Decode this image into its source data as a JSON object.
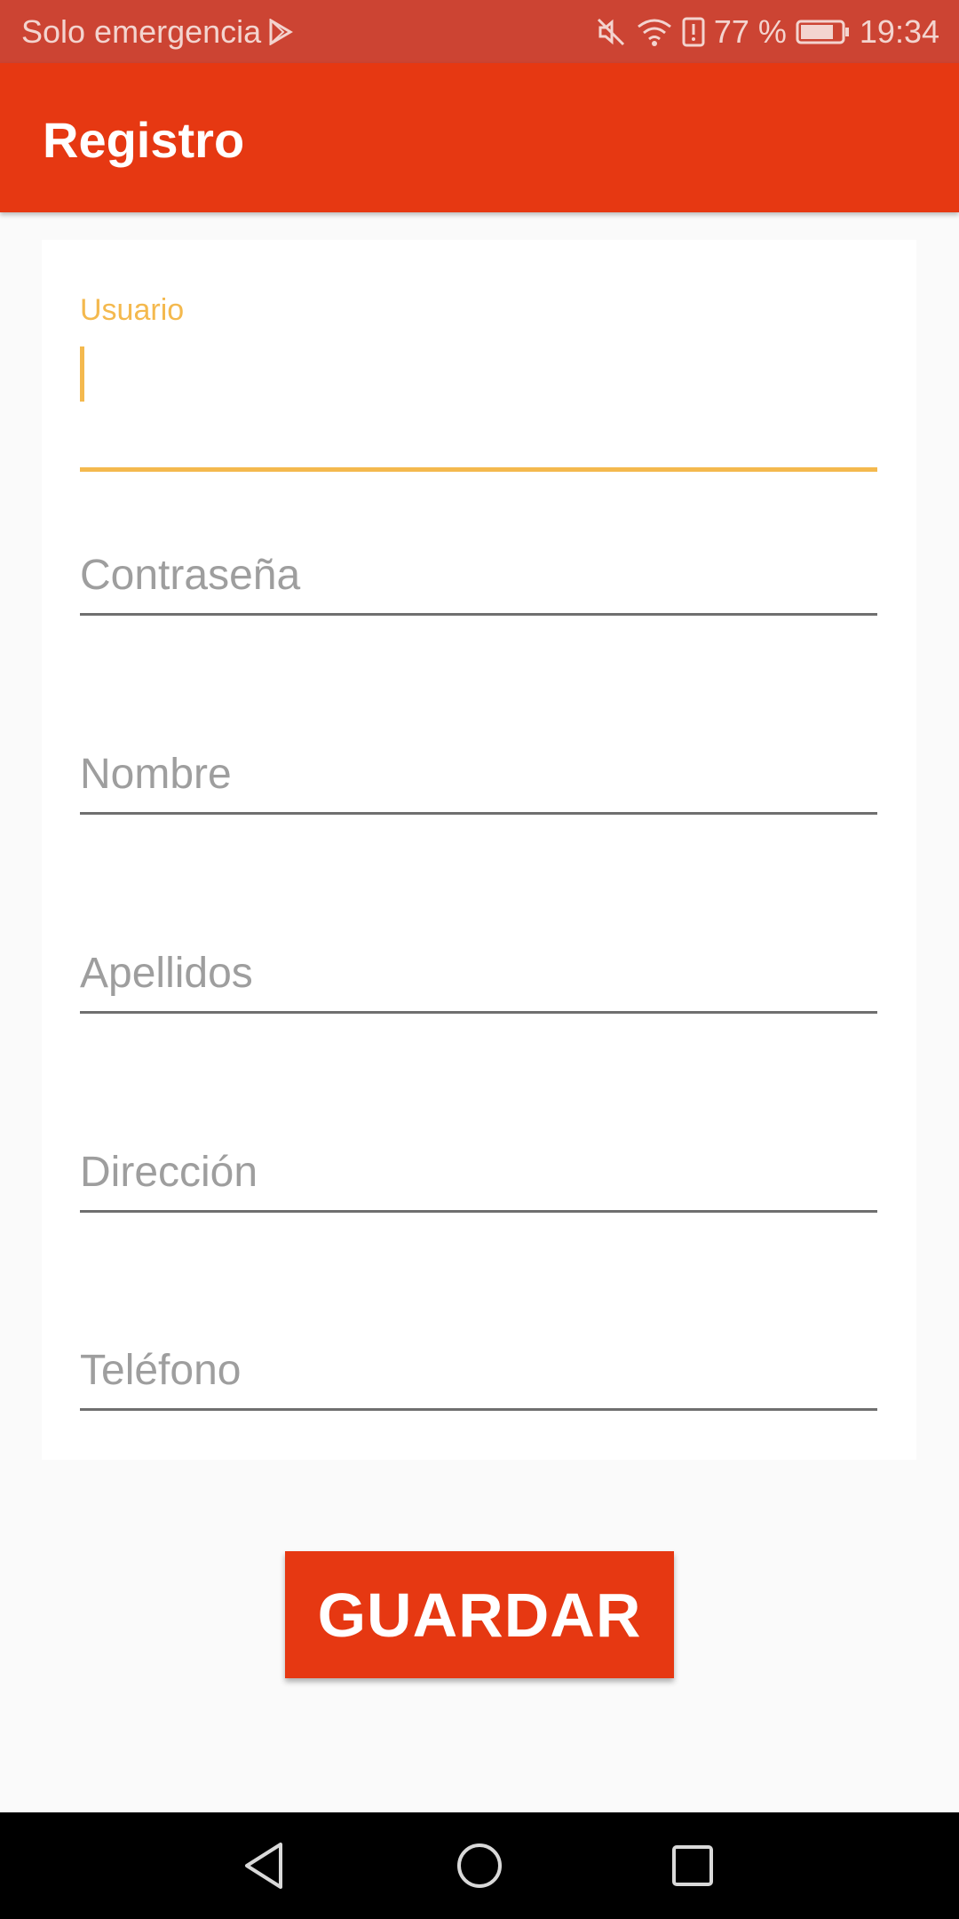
{
  "status_bar": {
    "carrier": "Solo emergencia",
    "battery": "77 %",
    "time": "19:34",
    "icons": [
      "play-store-icon",
      "mute-icon",
      "wifi-icon",
      "alert-icon",
      "battery-icon"
    ]
  },
  "app_bar": {
    "title": "Registro"
  },
  "form": {
    "usuario": {
      "label": "Usuario",
      "value": ""
    },
    "contrasena": {
      "placeholder": "Contraseña",
      "value": ""
    },
    "nombre": {
      "placeholder": "Nombre",
      "value": ""
    },
    "apellidos": {
      "placeholder": "Apellidos",
      "value": ""
    },
    "direccion": {
      "placeholder": "Dirección",
      "value": ""
    },
    "telefono": {
      "placeholder": "Teléfono",
      "value": ""
    }
  },
  "actions": {
    "save_label": "GUARDAR"
  },
  "nav_bar": {
    "icons": [
      "back-icon",
      "home-icon",
      "recents-icon"
    ]
  },
  "colors": {
    "primary": "#e63812",
    "status_bar": "#cc4433",
    "accent": "#f4b94e",
    "background": "#fafafa"
  }
}
